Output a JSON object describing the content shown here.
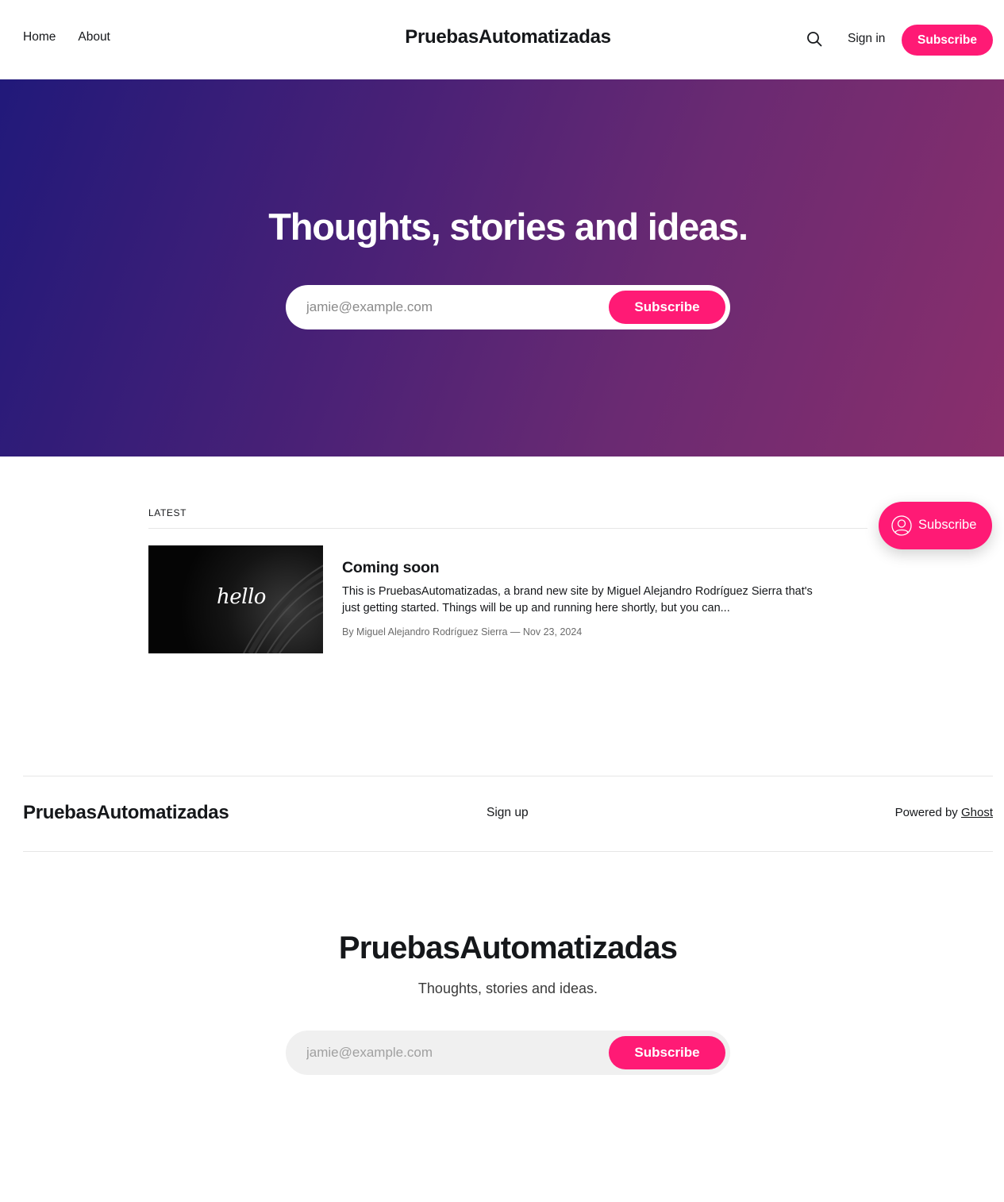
{
  "header": {
    "nav": [
      "Home",
      "About"
    ],
    "brand": "PruebasAutomatizadas",
    "search_icon": "search-icon",
    "signin_label": "Sign in",
    "subscribe_label": "Subscribe"
  },
  "hero": {
    "title": "Thoughts, stories and ideas.",
    "email_placeholder": "jamie@example.com",
    "subscribe_label": "Subscribe"
  },
  "latest": {
    "label": "LATEST",
    "post": {
      "thumbnail_text": "hello",
      "title": "Coming soon",
      "excerpt": "This is PruebasAutomatizadas, a brand new site by Miguel Alejandro Rodríguez Sierra that's just getting started. Things will be up and running here shortly, but you can...",
      "meta": "By Miguel Alejandro Rodríguez Sierra — Nov 23, 2024"
    }
  },
  "portal": {
    "label": "Subscribe",
    "icon": "user-circle-icon"
  },
  "footer": {
    "brand": "PruebasAutomatizadas",
    "signup_label": "Sign up",
    "powered_prefix": "Powered by ",
    "powered_link": "Ghost"
  },
  "cta": {
    "title": "PruebasAutomatizadas",
    "description": "Thoughts, stories and ideas.",
    "email_placeholder": "jamie@example.com",
    "subscribe_label": "Subscribe"
  },
  "colors": {
    "accent": "#ff1a75",
    "hero_gradient_start": "#21197a",
    "hero_gradient_end": "#8a2f6c",
    "text": "#15171a"
  }
}
